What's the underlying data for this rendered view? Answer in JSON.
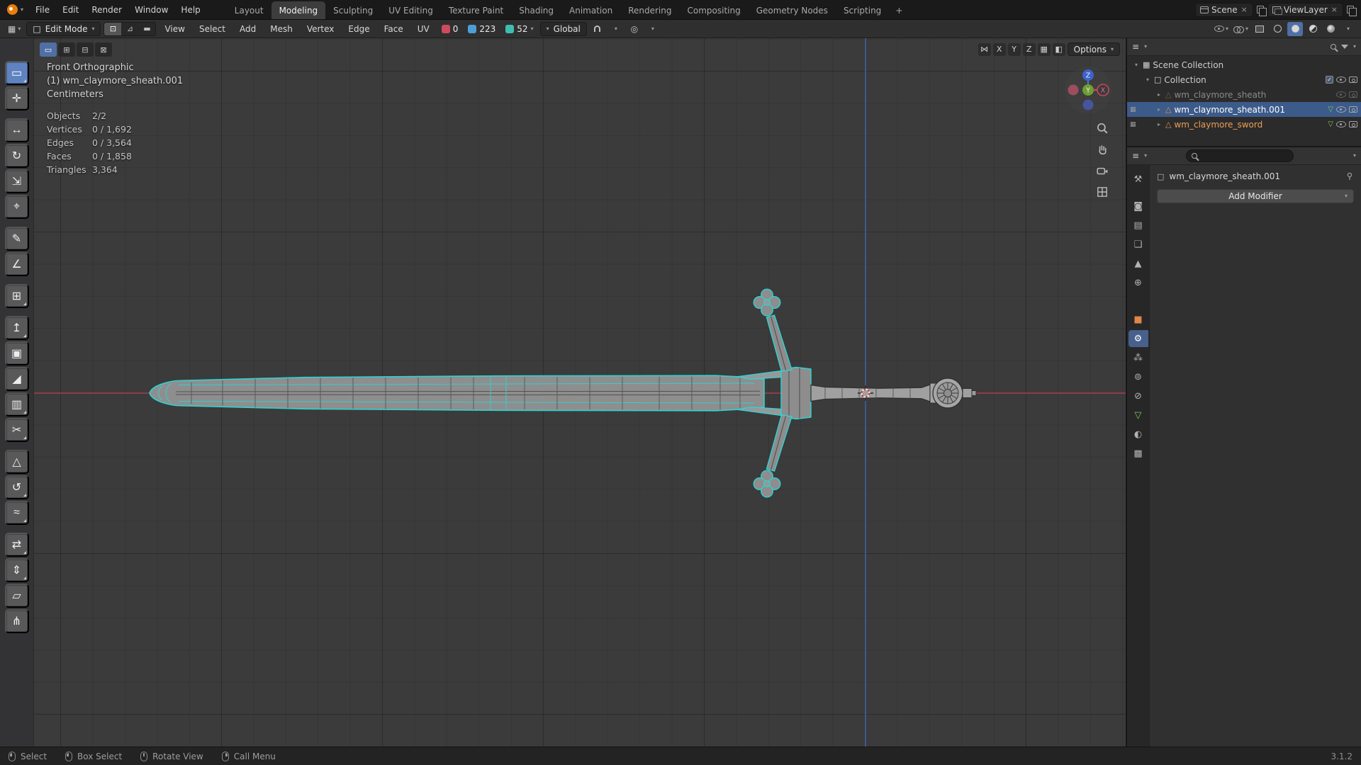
{
  "topbar": {
    "menus": [
      "File",
      "Edit",
      "Render",
      "Window",
      "Help"
    ],
    "workspaces": [
      "Layout",
      "Modeling",
      "Sculpting",
      "UV Editing",
      "Texture Paint",
      "Shading",
      "Animation",
      "Rendering",
      "Compositing",
      "Geometry Nodes",
      "Scripting"
    ],
    "active_workspace": "Modeling",
    "new_workspace": "+",
    "scene": {
      "label": "Scene"
    },
    "view_layer": {
      "label": "ViewLayer"
    }
  },
  "header": {
    "mode": "Edit Mode",
    "select_modes": [
      {
        "name": "set",
        "glyph": "▭"
      },
      {
        "name": "extend",
        "glyph": "⊞"
      },
      {
        "name": "subtract",
        "glyph": "⊟"
      },
      {
        "name": "intersect",
        "glyph": "⊠"
      }
    ],
    "menus": [
      "View",
      "Select",
      "Add",
      "Mesh",
      "Vertex",
      "Edge",
      "Face",
      "UV"
    ],
    "counters": {
      "red": "0",
      "blue": "223",
      "teal": "52"
    },
    "orientation": "Global",
    "options": "Options"
  },
  "toolbar": {
    "tools": [
      {
        "name": "select-box",
        "glyph": "▭"
      },
      {
        "name": "cursor",
        "glyph": "✛"
      },
      {
        "name": "move",
        "glyph": "↔"
      },
      {
        "name": "rotate",
        "glyph": "↻"
      },
      {
        "name": "scale",
        "glyph": "⇲"
      },
      {
        "name": "transform",
        "glyph": "⌖"
      },
      {
        "name": "annotate",
        "glyph": "✎"
      },
      {
        "name": "measure",
        "glyph": "∠"
      },
      {
        "name": "add-cube",
        "glyph": "⊞"
      },
      {
        "name": "extrude-region",
        "glyph": "↥"
      },
      {
        "name": "inset-faces",
        "glyph": "▣"
      },
      {
        "name": "bevel",
        "glyph": "◢"
      },
      {
        "name": "loop-cut",
        "glyph": "▥"
      },
      {
        "name": "knife",
        "glyph": "✂"
      },
      {
        "name": "poly-build",
        "glyph": "△"
      },
      {
        "name": "spin",
        "glyph": "↺"
      },
      {
        "name": "smooth",
        "glyph": "≈"
      },
      {
        "name": "edge-slide",
        "glyph": "⇄"
      },
      {
        "name": "shrink-fatten",
        "glyph": "⇕"
      },
      {
        "name": "shear",
        "glyph": "▱"
      },
      {
        "name": "rip-region",
        "glyph": "⋔"
      }
    ]
  },
  "viewport": {
    "view_name": "Front Orthographic",
    "active_object": "(1) wm_claymore_sheath.001",
    "units": "Centimeters",
    "stats": [
      {
        "label": "Objects",
        "value": "2/2"
      },
      {
        "label": "Vertices",
        "value": "0 / 1,692"
      },
      {
        "label": "Edges",
        "value": "0 / 3,564"
      },
      {
        "label": "Faces",
        "value": "0 / 1,858"
      },
      {
        "label": "Triangles",
        "value": "3,364"
      }
    ],
    "axes": [
      "X",
      "Y",
      "Z"
    ],
    "gizmo": {
      "x": "X",
      "y": "Y",
      "z": "Z"
    }
  },
  "outliner": {
    "root": "Scene Collection",
    "collection": "Collection",
    "objects": [
      {
        "label": "wm_claymore_sheath",
        "state": "hidden"
      },
      {
        "label": "wm_claymore_sheath.001",
        "state": "active"
      },
      {
        "label": "wm_claymore_sword",
        "state": "selected"
      }
    ]
  },
  "properties": {
    "tabs": [
      {
        "name": "tool",
        "glyph": "⚒"
      },
      {
        "name": "render",
        "glyph": "◙"
      },
      {
        "name": "output",
        "glyph": "▤"
      },
      {
        "name": "view-layer",
        "glyph": "❏"
      },
      {
        "name": "scene",
        "glyph": "▲"
      },
      {
        "name": "world",
        "glyph": "⊕"
      },
      {
        "name": "object",
        "glyph": "■"
      },
      {
        "name": "modifiers",
        "glyph": "⚙"
      },
      {
        "name": "particles",
        "glyph": "⁂"
      },
      {
        "name": "physics",
        "glyph": "⊚"
      },
      {
        "name": "constraints",
        "glyph": "⊘"
      },
      {
        "name": "object-data",
        "glyph": "▽"
      },
      {
        "name": "material",
        "glyph": "◐"
      },
      {
        "name": "texture",
        "glyph": "▩"
      }
    ],
    "breadcrumb": "wm_claymore_sheath.001",
    "add_modifier": "Add Modifier"
  },
  "statusbar": {
    "hints": [
      {
        "label": "Select",
        "button": "left"
      },
      {
        "label": "Box Select",
        "button": "left"
      },
      {
        "label": "Rotate View",
        "button": "middle"
      },
      {
        "label": "Call Menu",
        "button": "right"
      }
    ],
    "version": "3.1.2"
  },
  "icons": {
    "caret": "▾",
    "tri_right": "▸",
    "tri_down": "▾",
    "close": "×",
    "check": "✓",
    "vertex": "⊡",
    "edge": "⊿",
    "face": "▬",
    "proportional": "◎",
    "mirror": "⋈",
    "gridbox": "▦",
    "half_square": "◧",
    "menu": "≡",
    "square": "□",
    "object_tri": "△",
    "data_tri": "▽"
  },
  "colors": {
    "accent_orange": "#e8833a",
    "edit_cyan": "#2fd3d3",
    "axis_red": "#9d3e4e",
    "axis_blue": "#4063a6",
    "active_tool_blue": "#5f83c0"
  }
}
